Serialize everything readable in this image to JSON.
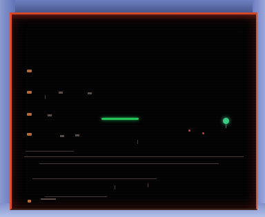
{
  "display": {
    "border_color": "#e04e2f",
    "background_color": "#020203",
    "trace_color": "#26c45b",
    "signal_color": "#3acb84"
  },
  "panel": {
    "left_markers": [
      {
        "icon": "pointer-icon"
      },
      {
        "icon": "pointer-icon"
      },
      {
        "icon": "pointer-icon"
      },
      {
        "icon": "pointer-icon"
      }
    ],
    "bottom_marker": {
      "icon": "pointer-icon"
    }
  }
}
